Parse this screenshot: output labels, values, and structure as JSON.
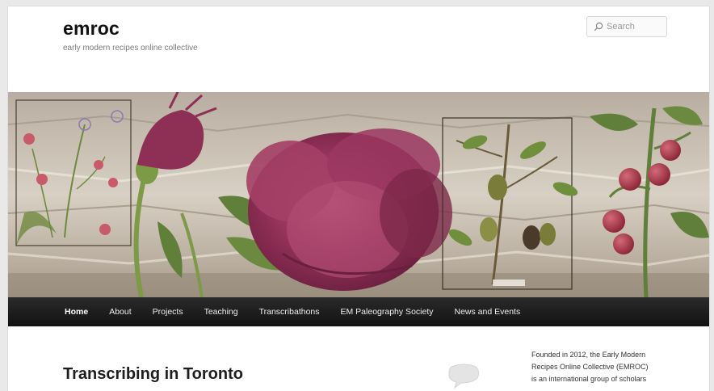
{
  "site": {
    "title": "emroc",
    "description": "early modern recipes online collective"
  },
  "search": {
    "placeholder": "Search"
  },
  "nav": {
    "items": [
      "Home",
      "About",
      "Projects",
      "Teaching",
      "Transcribathons",
      "EM Paleography Society",
      "News and Events"
    ]
  },
  "post": {
    "title": "Transcribing in Toronto"
  },
  "sidebar": {
    "lines": [
      "Founded in 2012, the Early Modern",
      "Recipes Online Collective (EMROC)",
      "is an international group of scholars"
    ]
  },
  "colors": {
    "nav_bg": "#1a1a1a",
    "peony": "#9a3a5e",
    "leaf": "#5f7f3a",
    "paper": "#cfc6b8"
  },
  "icons": [
    "search-icon",
    "comment-bubble-icon"
  ]
}
